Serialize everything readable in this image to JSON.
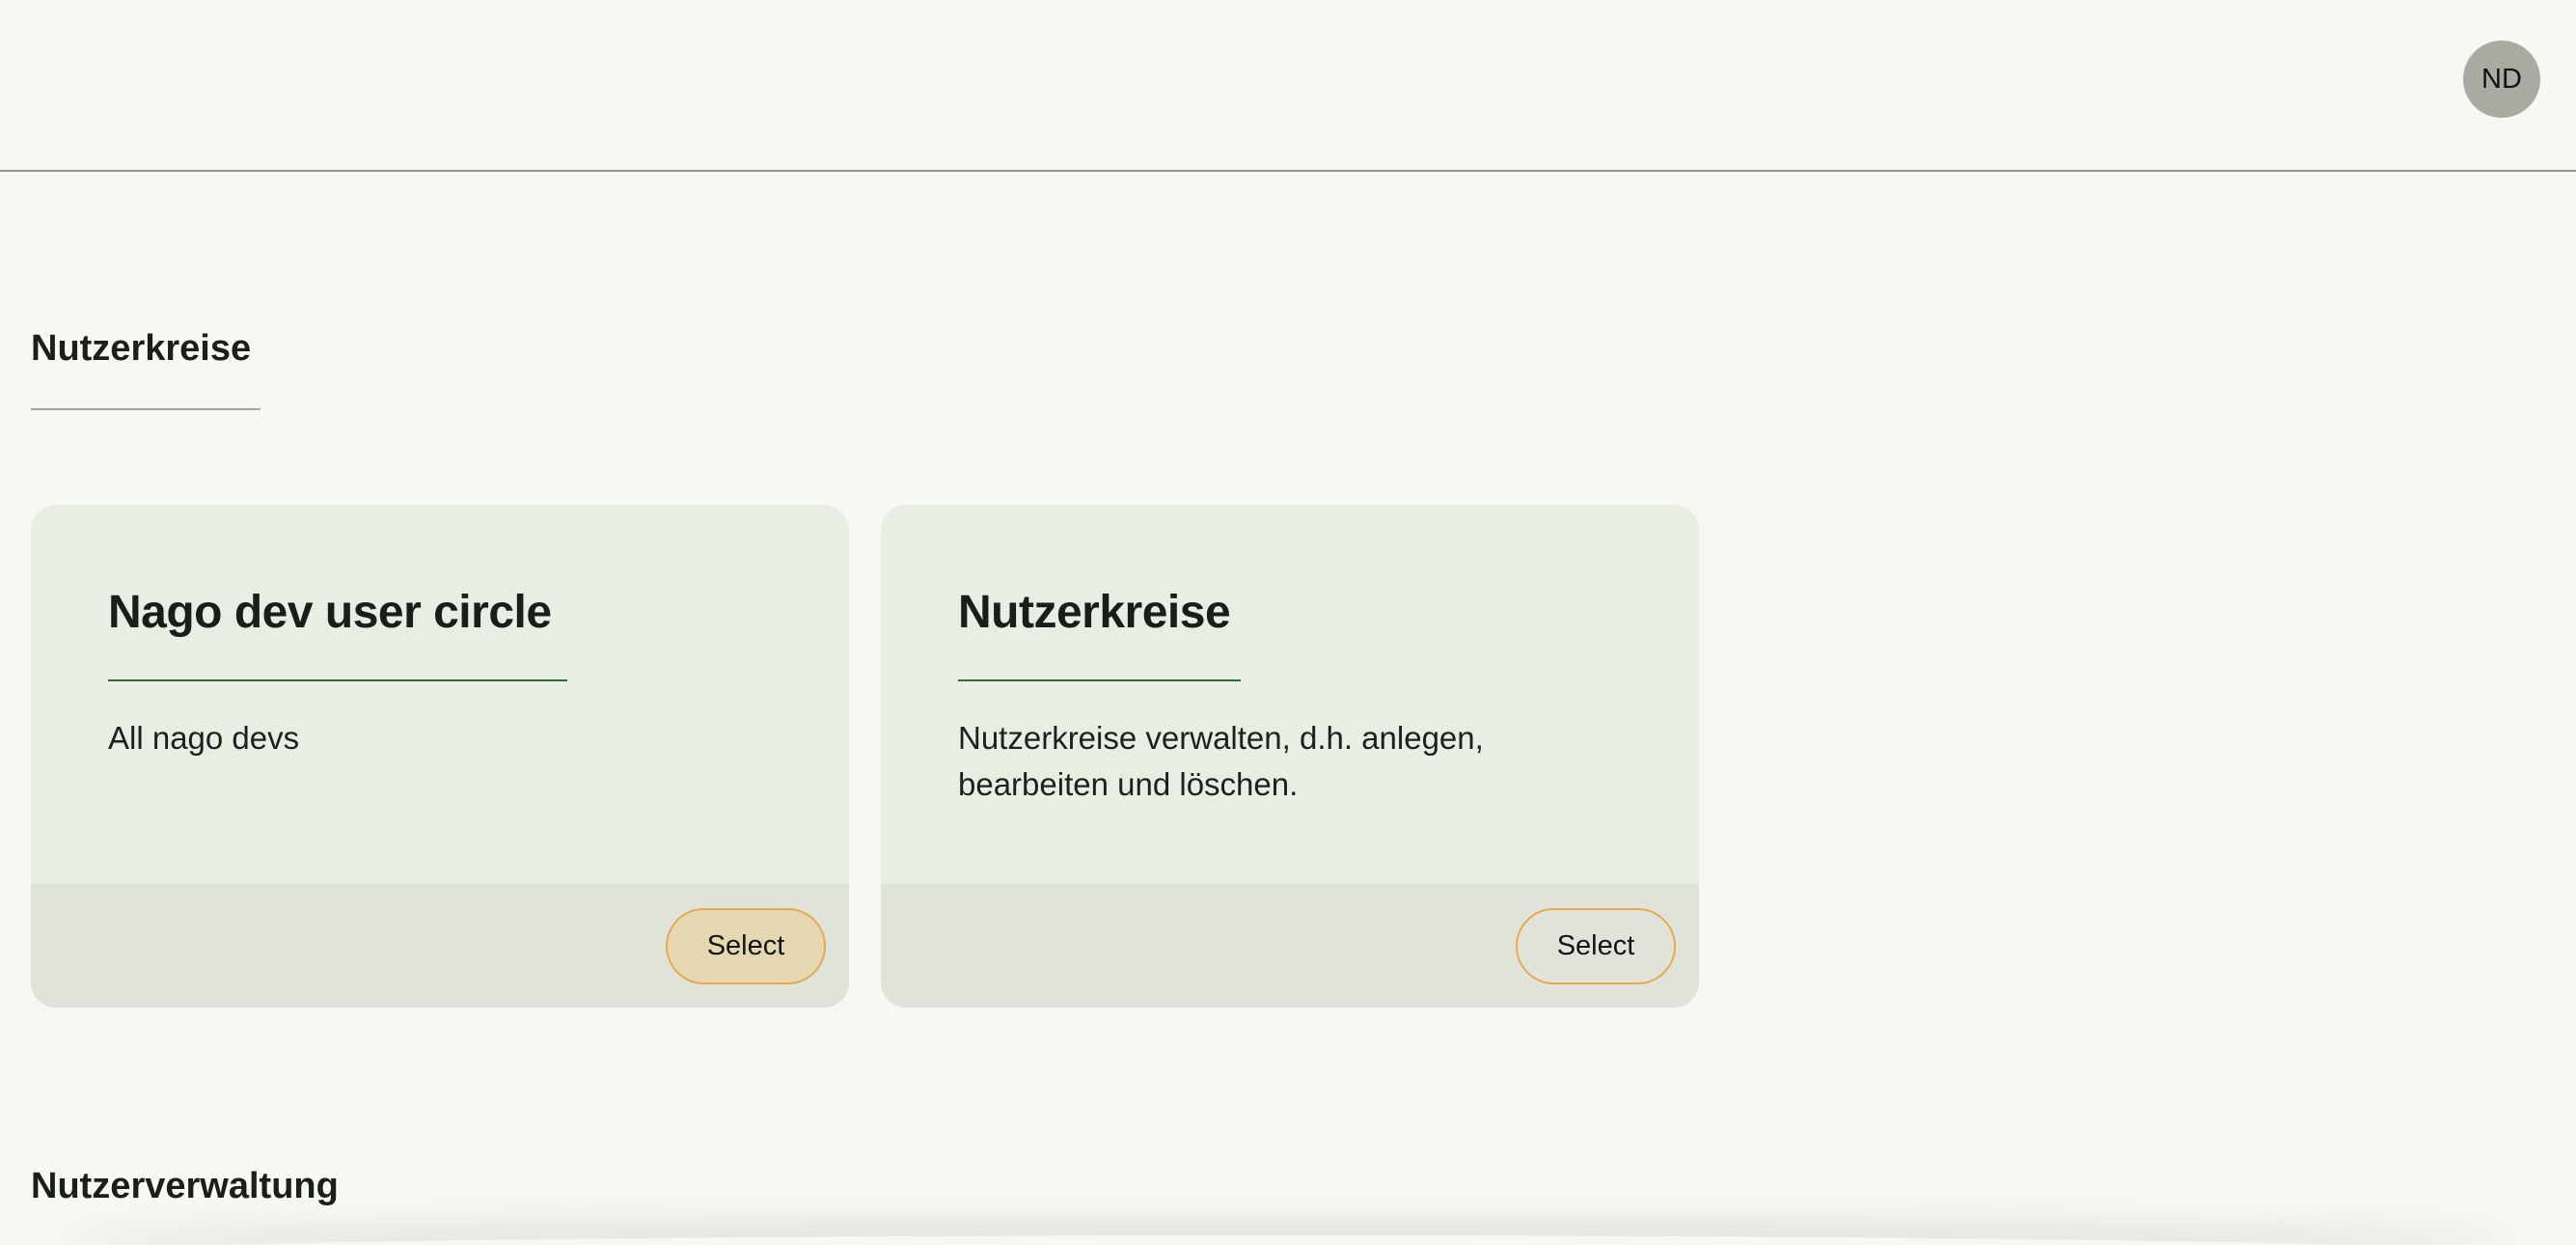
{
  "header": {
    "avatar_initials": "ND"
  },
  "sections": [
    {
      "title": "Nutzerkreise",
      "cards": [
        {
          "title": "Nago dev user circle",
          "description": "All nago devs",
          "button_label": "Select",
          "button_active": true
        },
        {
          "title": "Nutzerkreise",
          "description": "Nutzerkreise verwalten, d.h. anlegen, bearbeiten und löschen.",
          "button_label": "Select",
          "button_active": false
        }
      ]
    },
    {
      "title": "Nutzerverwaltung"
    }
  ],
  "colors": {
    "background": "#f8f8f3",
    "card_body": "#e9eee5",
    "card_footer": "#e0e3d9",
    "accent_border": "#e7a84a",
    "active_button_fill": "#e6d7b3",
    "title_underline": "#2e6a3b",
    "avatar": "#a7aba2"
  }
}
